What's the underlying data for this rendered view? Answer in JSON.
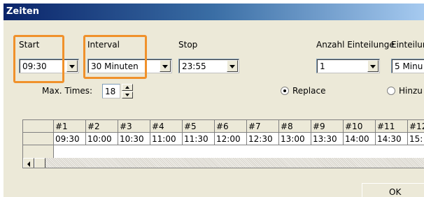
{
  "window": {
    "title": "Zeiten"
  },
  "fields": {
    "start": {
      "label": "Start",
      "value": "09:30"
    },
    "interval": {
      "label": "Interval",
      "value": "30 Minuten"
    },
    "stop": {
      "label": "Stop",
      "value": "23:55"
    },
    "anzahl": {
      "label": "Anzahl Einteilunge",
      "value": "1"
    },
    "einteilung": {
      "label": "Einteilun",
      "value": "5 Minu"
    },
    "max_times": {
      "label": "Max. Times:",
      "value": "18"
    }
  },
  "radios": {
    "replace": {
      "label": "Replace",
      "checked": true
    },
    "hinzu": {
      "label": "Hinzu",
      "checked": false
    }
  },
  "grid": {
    "headers": [
      "#1",
      "#2",
      "#3",
      "#4",
      "#5",
      "#6",
      "#7",
      "#8",
      "#9",
      "#10",
      "#11",
      "#12"
    ],
    "times": [
      "09:30",
      "10:00",
      "10:30",
      "11:00",
      "11:30",
      "12:00",
      "12:30",
      "13:00",
      "13:30",
      "14:00",
      "14:30",
      "15:"
    ]
  },
  "buttons": {
    "ok": "OK"
  },
  "colors": {
    "highlight": "#F0912B",
    "titlebar": "#0A246A",
    "dialog_bg": "#ECE9D8"
  }
}
